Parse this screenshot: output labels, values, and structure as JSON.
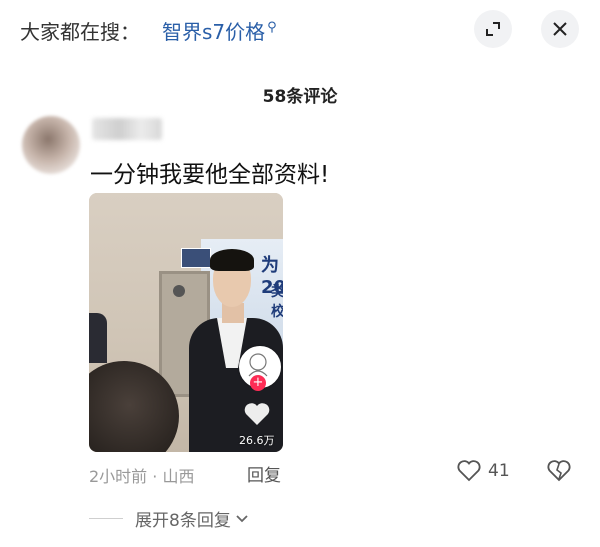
{
  "search": {
    "prefix": "大家都在搜：",
    "term": "智界s7价格"
  },
  "header": {
    "comment_count": "58条评论"
  },
  "comment": {
    "text": "一分钟我要他全部资料!",
    "image": {
      "likes": "26.6万"
    },
    "meta": "2小时前 · 山西",
    "reply_label": "回复",
    "like_count": "41",
    "expand_label": "展开8条回复"
  },
  "icons": {
    "search_term": "search-icon",
    "expand_window": "expand-icon",
    "close": "close-icon",
    "like": "heart-outline-icon",
    "dislike": "broken-heart-icon",
    "chevron": "chevron-down-icon"
  },
  "colors": {
    "search_term": "#2a5fa8",
    "plus_badge": "#fe2c55"
  }
}
